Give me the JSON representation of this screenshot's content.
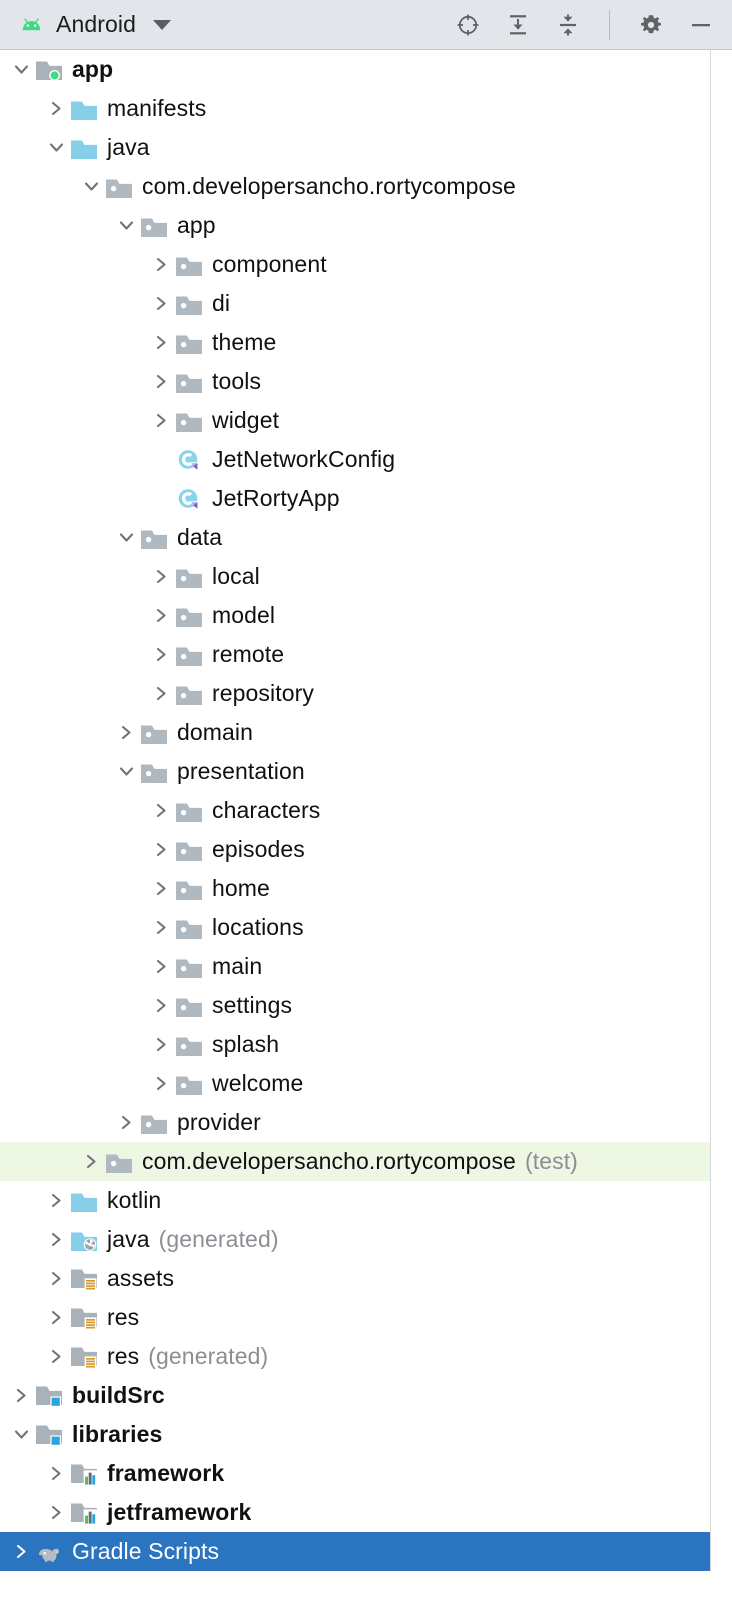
{
  "toolbar": {
    "title": "Android",
    "logo_icon": "android-robot-icon",
    "dropdown_icon": "chevron-down-icon",
    "actions": [
      {
        "name": "select-opened-file-icon",
        "label": "Select Opened File"
      },
      {
        "name": "expand-all-icon",
        "label": "Expand All"
      },
      {
        "name": "collapse-all-icon",
        "label": "Collapse All"
      },
      {
        "name": "settings-gear-icon",
        "label": "Settings"
      },
      {
        "name": "hide-minimize-icon",
        "label": "Hide"
      }
    ]
  },
  "colors": {
    "header_bg": "#e2e5e9",
    "selection_blue": "#2a74c0",
    "test_highlight_green": "#eef6e4",
    "folder_blue": "#87cfe8",
    "folder_gray": "#b0b9c0",
    "module_badge_blue": "#29a7dd",
    "module_dot_green": "#3ddb85",
    "kotlin_circle": "#8ad4e8",
    "kotlin_badge_purple": "#b99cea",
    "suffix_gray": "#8b8f94",
    "text_black": "#111111"
  },
  "tree": {
    "rows": [
      {
        "label": "app",
        "suffix": "",
        "depth": 0,
        "twisty": "expanded",
        "icon": "module-folder-green-dot-icon",
        "bold": true,
        "state": "normal"
      },
      {
        "label": "manifests",
        "suffix": "",
        "depth": 1,
        "twisty": "collapsed",
        "icon": "folder-blue-icon",
        "bold": false,
        "state": "normal"
      },
      {
        "label": "java",
        "suffix": "",
        "depth": 1,
        "twisty": "expanded",
        "icon": "folder-blue-icon",
        "bold": false,
        "state": "normal"
      },
      {
        "label": "com.developersancho.rortycompose",
        "suffix": "",
        "depth": 2,
        "twisty": "expanded",
        "icon": "package-folder-icon",
        "bold": false,
        "state": "normal"
      },
      {
        "label": "app",
        "suffix": "",
        "depth": 3,
        "twisty": "expanded",
        "icon": "package-folder-icon",
        "bold": false,
        "state": "normal"
      },
      {
        "label": "component",
        "suffix": "",
        "depth": 4,
        "twisty": "collapsed",
        "icon": "package-folder-icon",
        "bold": false,
        "state": "normal"
      },
      {
        "label": "di",
        "suffix": "",
        "depth": 4,
        "twisty": "collapsed",
        "icon": "package-folder-icon",
        "bold": false,
        "state": "normal"
      },
      {
        "label": "theme",
        "suffix": "",
        "depth": 4,
        "twisty": "collapsed",
        "icon": "package-folder-icon",
        "bold": false,
        "state": "normal"
      },
      {
        "label": "tools",
        "suffix": "",
        "depth": 4,
        "twisty": "collapsed",
        "icon": "package-folder-icon",
        "bold": false,
        "state": "normal"
      },
      {
        "label": "widget",
        "suffix": "",
        "depth": 4,
        "twisty": "collapsed",
        "icon": "package-folder-icon",
        "bold": false,
        "state": "normal"
      },
      {
        "label": "JetNetworkConfig",
        "suffix": "",
        "depth": 4,
        "twisty": "none",
        "icon": "kotlin-class-icon",
        "bold": false,
        "state": "normal"
      },
      {
        "label": "JetRortyApp",
        "suffix": "",
        "depth": 4,
        "twisty": "none",
        "icon": "kotlin-class-icon",
        "bold": false,
        "state": "normal"
      },
      {
        "label": "data",
        "suffix": "",
        "depth": 3,
        "twisty": "expanded",
        "icon": "package-folder-icon",
        "bold": false,
        "state": "normal"
      },
      {
        "label": "local",
        "suffix": "",
        "depth": 4,
        "twisty": "collapsed",
        "icon": "package-folder-icon",
        "bold": false,
        "state": "normal"
      },
      {
        "label": "model",
        "suffix": "",
        "depth": 4,
        "twisty": "collapsed",
        "icon": "package-folder-icon",
        "bold": false,
        "state": "normal"
      },
      {
        "label": "remote",
        "suffix": "",
        "depth": 4,
        "twisty": "collapsed",
        "icon": "package-folder-icon",
        "bold": false,
        "state": "normal"
      },
      {
        "label": "repository",
        "suffix": "",
        "depth": 4,
        "twisty": "collapsed",
        "icon": "package-folder-icon",
        "bold": false,
        "state": "normal"
      },
      {
        "label": "domain",
        "suffix": "",
        "depth": 3,
        "twisty": "collapsed",
        "icon": "package-folder-icon",
        "bold": false,
        "state": "normal"
      },
      {
        "label": "presentation",
        "suffix": "",
        "depth": 3,
        "twisty": "expanded",
        "icon": "package-folder-icon",
        "bold": false,
        "state": "normal"
      },
      {
        "label": "characters",
        "suffix": "",
        "depth": 4,
        "twisty": "collapsed",
        "icon": "package-folder-icon",
        "bold": false,
        "state": "normal"
      },
      {
        "label": "episodes",
        "suffix": "",
        "depth": 4,
        "twisty": "collapsed",
        "icon": "package-folder-icon",
        "bold": false,
        "state": "normal"
      },
      {
        "label": "home",
        "suffix": "",
        "depth": 4,
        "twisty": "collapsed",
        "icon": "package-folder-icon",
        "bold": false,
        "state": "normal"
      },
      {
        "label": "locations",
        "suffix": "",
        "depth": 4,
        "twisty": "collapsed",
        "icon": "package-folder-icon",
        "bold": false,
        "state": "normal"
      },
      {
        "label": "main",
        "suffix": "",
        "depth": 4,
        "twisty": "collapsed",
        "icon": "package-folder-icon",
        "bold": false,
        "state": "normal"
      },
      {
        "label": "settings",
        "suffix": "",
        "depth": 4,
        "twisty": "collapsed",
        "icon": "package-folder-icon",
        "bold": false,
        "state": "normal"
      },
      {
        "label": "splash",
        "suffix": "",
        "depth": 4,
        "twisty": "collapsed",
        "icon": "package-folder-icon",
        "bold": false,
        "state": "normal"
      },
      {
        "label": "welcome",
        "suffix": "",
        "depth": 4,
        "twisty": "collapsed",
        "icon": "package-folder-icon",
        "bold": false,
        "state": "normal"
      },
      {
        "label": "provider",
        "suffix": "",
        "depth": 3,
        "twisty": "collapsed",
        "icon": "package-folder-icon",
        "bold": false,
        "state": "normal"
      },
      {
        "label": "com.developersancho.rortycompose",
        "suffix": "(test)",
        "depth": 2,
        "twisty": "collapsed",
        "icon": "package-folder-icon",
        "bold": false,
        "state": "test"
      },
      {
        "label": "kotlin",
        "suffix": "",
        "depth": 1,
        "twisty": "collapsed",
        "icon": "folder-blue-icon",
        "bold": false,
        "state": "normal"
      },
      {
        "label": "java",
        "suffix": "(generated)",
        "depth": 1,
        "twisty": "collapsed",
        "icon": "folder-blue-generated-icon",
        "bold": false,
        "state": "normal"
      },
      {
        "label": "assets",
        "suffix": "",
        "depth": 1,
        "twisty": "collapsed",
        "icon": "folder-resource-icon",
        "bold": false,
        "state": "normal"
      },
      {
        "label": "res",
        "suffix": "",
        "depth": 1,
        "twisty": "collapsed",
        "icon": "folder-resource-icon",
        "bold": false,
        "state": "normal"
      },
      {
        "label": "res",
        "suffix": "(generated)",
        "depth": 1,
        "twisty": "collapsed",
        "icon": "folder-resource-icon",
        "bold": false,
        "state": "normal"
      },
      {
        "label": "buildSrc",
        "suffix": "",
        "depth": 0,
        "twisty": "collapsed",
        "icon": "module-folder-blue-icon",
        "bold": true,
        "state": "normal"
      },
      {
        "label": "libraries",
        "suffix": "",
        "depth": 0,
        "twisty": "expanded",
        "icon": "module-folder-blue-icon",
        "bold": true,
        "state": "normal"
      },
      {
        "label": "framework",
        "suffix": "",
        "depth": 1,
        "twisty": "collapsed",
        "icon": "android-library-module-icon",
        "bold": true,
        "state": "normal"
      },
      {
        "label": "jetframework",
        "suffix": "",
        "depth": 1,
        "twisty": "collapsed",
        "icon": "android-library-module-icon",
        "bold": true,
        "state": "normal"
      },
      {
        "label": "Gradle Scripts",
        "suffix": "",
        "depth": 0,
        "twisty": "collapsed",
        "icon": "gradle-elephant-icon",
        "bold": false,
        "state": "selected"
      }
    ]
  }
}
